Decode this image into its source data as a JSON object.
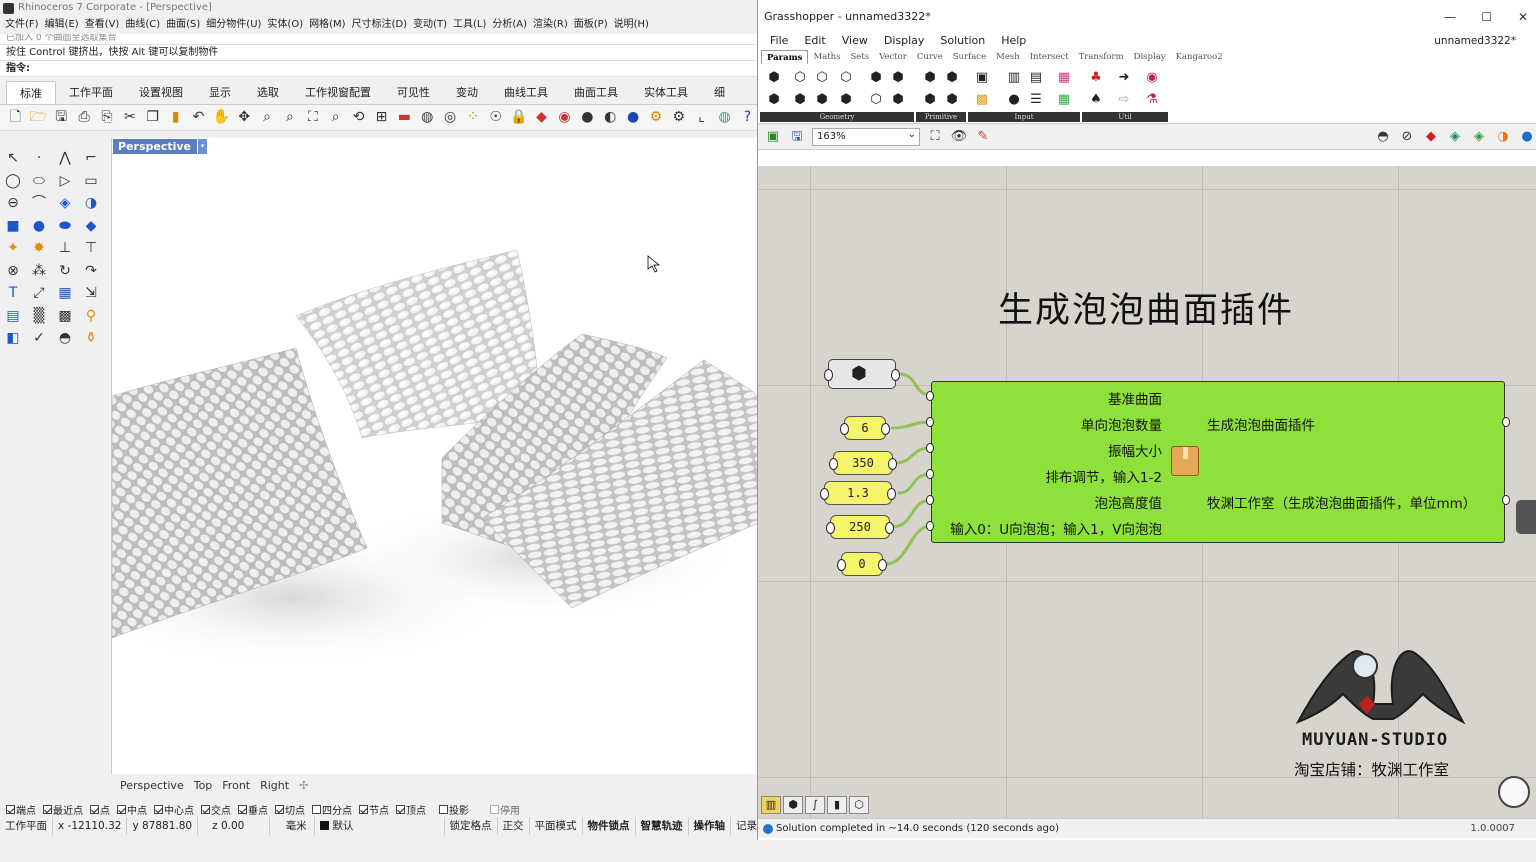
{
  "rhino": {
    "title": "Rhinoceros 7 Corporate - [Perspective]",
    "menu": [
      "文件(F)",
      "编辑(E)",
      "查看(V)",
      "曲线(C)",
      "曲面(S)",
      "细分物件(U)",
      "实体(O)",
      "网格(M)",
      "尺寸标注(D)",
      "变动(T)",
      "工具(L)",
      "分析(A)",
      "渲染(R)",
      "面板(P)",
      "说明(H)"
    ],
    "command_history_ghost": "已加入 0 个曲面至选取集合",
    "command_hint": "按住 Control 键挤出，快按 Alt 键可以复制物件",
    "command_prompt": "指令:",
    "ribbon_tabs": [
      "标准",
      "工作平面",
      "设置视图",
      "显示",
      "选取",
      "工作视窗配置",
      "可见性",
      "变动",
      "曲线工具",
      "曲面工具",
      "实体工具",
      "细"
    ],
    "viewport_label": "Perspective",
    "viewport_tabs": [
      "Perspective",
      "Top",
      "Front",
      "Right",
      "✣"
    ],
    "osnaps": [
      {
        "label": "端点",
        "checked": true
      },
      {
        "label": "最近点",
        "checked": true
      },
      {
        "label": "点",
        "checked": true
      },
      {
        "label": "中点",
        "checked": true
      },
      {
        "label": "中心点",
        "checked": true
      },
      {
        "label": "交点",
        "checked": true
      },
      {
        "label": "垂点",
        "checked": true
      },
      {
        "label": "切点",
        "checked": true
      },
      {
        "label": "四分点",
        "checked": false
      },
      {
        "label": "节点",
        "checked": true
      },
      {
        "label": "顶点",
        "checked": true
      },
      {
        "label": "投影",
        "checked": false
      },
      {
        "label": "停用",
        "checked": false
      }
    ],
    "status": {
      "cplane": "工作平面",
      "x": "x -12110.32",
      "y": "y 87881.80",
      "z": "z 0.00",
      "units": "毫米",
      "layer": "默认",
      "toggles": [
        "锁定格点",
        "正交",
        "平面模式",
        "物件锁点",
        "智慧轨迹",
        "操作轴",
        "记录"
      ]
    }
  },
  "gh": {
    "title": "Grasshopper - unnamed3322*",
    "window_controls": [
      "—",
      "☐",
      "✕"
    ],
    "menu": [
      "File",
      "Edit",
      "View",
      "Display",
      "Solution",
      "Help"
    ],
    "document": "unnamed3322*",
    "tabs": [
      "Params",
      "Maths",
      "Sets",
      "Vector",
      "Curve",
      "Surface",
      "Mesh",
      "Intersect",
      "Transform",
      "Display",
      "Kangaroo2"
    ],
    "groups": [
      "Geometry",
      "Primitive",
      "Input",
      "Util"
    ],
    "zoom": "163%",
    "canvas_title": "生成泡泡曲面插件",
    "params": [
      "6",
      "350",
      "1.3",
      "250",
      "0"
    ],
    "cluster": {
      "inputs": [
        "基准曲面",
        "单向泡泡数量",
        "振幅大小",
        "排布调节，输入1-2",
        "泡泡高度值",
        "输入0：U向泡泡；输入1，V向泡泡"
      ],
      "outputs": [
        "生成泡泡曲面插件",
        "牧渊工作室（生成泡泡曲面插件，单位mm）"
      ]
    },
    "logo_name": "MUYUAN-STUDIO",
    "logo_shop": "淘宝店铺：牧渊工作室",
    "status": "Solution completed in ~14.0 seconds (120 seconds ago)",
    "version": "1.0.0007"
  }
}
